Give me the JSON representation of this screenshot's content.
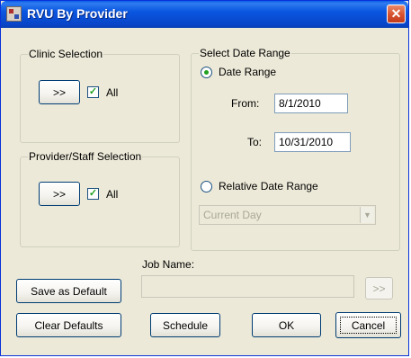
{
  "window": {
    "title": "RVU By Provider",
    "close_glyph": "✕"
  },
  "clinic": {
    "legend": "Clinic Selection",
    "button": ">>",
    "all_label": "All",
    "all_checked": true
  },
  "provider": {
    "legend": "Provider/Staff Selection",
    "button": ">>",
    "all_label": "All",
    "all_checked": true
  },
  "date": {
    "legend": "Select Date Range",
    "range_label": "Date Range",
    "from_label": "From:",
    "from_value": "8/1/2010",
    "to_label": "To:",
    "to_value": "10/31/2010",
    "relative_label": "Relative Date Range",
    "relative_value": "Current Day",
    "selected": "Date Range"
  },
  "job": {
    "label": "Job Name:",
    "value": "",
    "button": ">>"
  },
  "buttons": {
    "save_default": "Save as Default",
    "clear_defaults": "Clear Defaults",
    "schedule": "Schedule",
    "ok": "OK",
    "cancel": "Cancel"
  },
  "icons": {
    "app": "app-icon",
    "checkbox_mark": "✓",
    "dropdown": "▼"
  }
}
